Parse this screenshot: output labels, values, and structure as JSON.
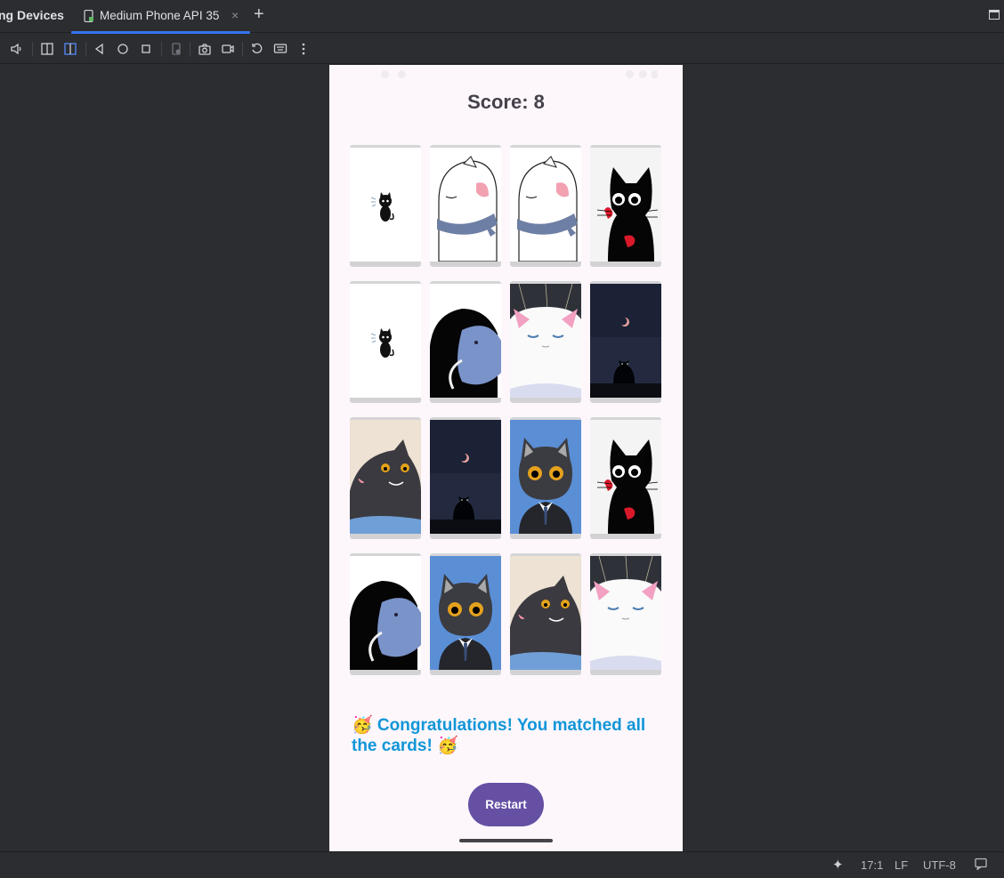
{
  "ide": {
    "left_tab_label": "ng Devices",
    "active_tab_label": "Medium Phone API 35",
    "close_glyph": "×",
    "add_glyph": "+",
    "accent_color": "#3574f0",
    "toolbar_icons": [
      "volume-icon",
      "fold-left-icon",
      "fold-right-icon",
      "back-icon",
      "home-icon",
      "overview-icon",
      "device-icon",
      "camera-icon",
      "record-icon",
      "rotate-icon",
      "keyboard-icon",
      "more-icon"
    ]
  },
  "app": {
    "score_text": "Score: 8",
    "cards": [
      "small-black-cat",
      "white-cat-scarf",
      "white-cat-scarf",
      "black-cat-question",
      "small-black-cat",
      "black-cat-fish",
      "white-cat-snow",
      "cat-moon-night",
      "gray-cat-smile",
      "cat-moon-night",
      "gray-cat-suit",
      "black-cat-question",
      "black-cat-fish",
      "gray-cat-suit",
      "gray-cat-smile",
      "white-cat-snow"
    ],
    "congrats_text": "🥳 Congratulations! You matched all the cards! 🥳",
    "restart_label": "Restart",
    "primary_color": "#6650a4",
    "congrats_color": "#1196d8"
  },
  "status": {
    "line_col": "17:1",
    "line_sep": "LF",
    "encoding": "UTF-8"
  }
}
